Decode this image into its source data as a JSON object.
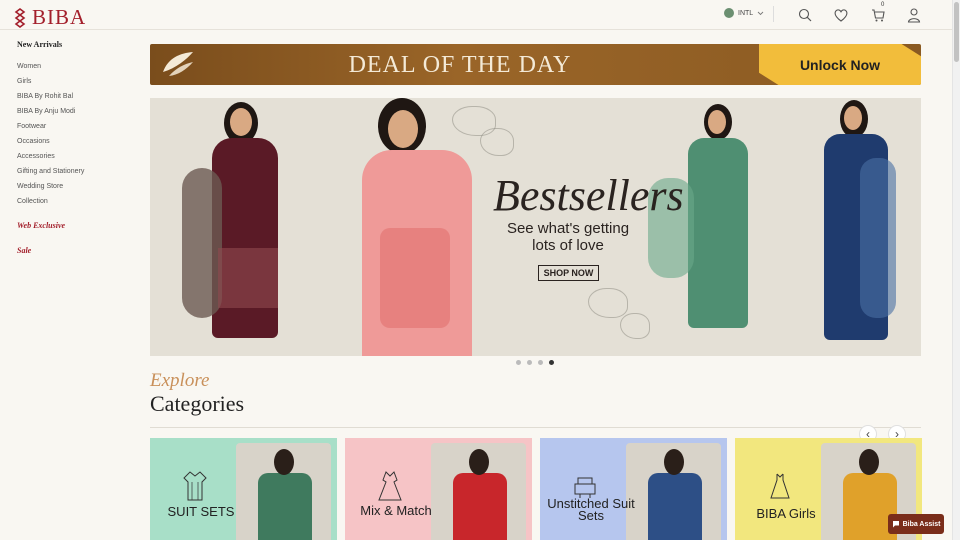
{
  "header": {
    "brand": "BIBA",
    "region": "INTL",
    "cart_count": "0",
    "icons": [
      "search-icon",
      "heart-icon",
      "cart-icon",
      "user-icon"
    ]
  },
  "sidebar": {
    "heading": "New Arrivals",
    "items": [
      "Women",
      "Girls",
      "BIBA By Rohit Bal",
      "BIBA By Anju Modi",
      "Footwear",
      "Occasions",
      "Accessories",
      "Gifting and Stationery",
      "Wedding Store",
      "Collection"
    ],
    "special": [
      "Web Exclusive",
      "Sale"
    ]
  },
  "deal": {
    "title": "DEAL OF THE DAY",
    "cta": "Unlock Now"
  },
  "hero": {
    "title": "Bestsellers",
    "subtitle": "See what's getting lots of love",
    "cta": "SHOP NOW",
    "slide_count": 4,
    "active_slide": 4
  },
  "categories": {
    "kicker": "Explore",
    "title": "Categories",
    "cards": [
      {
        "label": "SUIT SETS",
        "bg": "#a8dfc8",
        "dress": "#3f7a5e"
      },
      {
        "label": "Mix & Match",
        "bg": "#f6c4c6",
        "dress": "#c8262b"
      },
      {
        "label": "Unstitched Suit Sets",
        "bg": "#b6c6ee",
        "dress": "#2d4f86"
      },
      {
        "label": "BIBA Girls",
        "bg": "#f2e77e",
        "dress": "#e0a12a"
      }
    ]
  },
  "assist": {
    "label": "Biba Assist"
  },
  "colors": {
    "brand": "#a31f2b",
    "deal_bg": "#8a5a22",
    "deal_cta": "#f2bd3b"
  }
}
